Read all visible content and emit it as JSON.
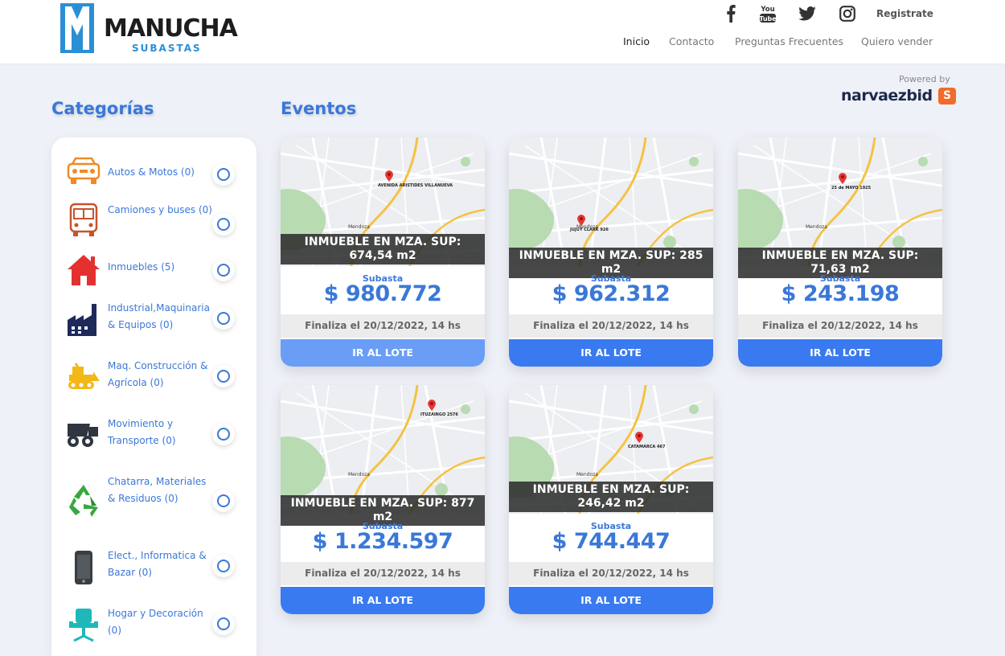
{
  "brand": {
    "name": "MANUCHA",
    "sub": "SUBASTAS"
  },
  "header": {
    "social": [
      "facebook-icon",
      "youtube-icon",
      "twitter-icon",
      "instagram-icon"
    ],
    "youtube_text": "You\nTube",
    "registrate": "Registrate",
    "nav": [
      "Inicio",
      "Contacto",
      "Preguntas Frecuentes",
      "Quiero vender"
    ]
  },
  "powered": {
    "label": "Powered by",
    "brand": "narvaezbid",
    "badge": "S"
  },
  "sidebar": {
    "title": "Categorías",
    "categories": [
      {
        "label": "Autos & Motos (0)",
        "icon": "car-icon"
      },
      {
        "label": "Camiones y buses (0)",
        "icon": "bus-icon"
      },
      {
        "label": "Inmuebles (5)",
        "icon": "house-icon"
      },
      {
        "label": "Industrial,Maquinaria & Equipos (0)",
        "icon": "factory-icon"
      },
      {
        "label": "Maq. Construcción & Agrícola (0)",
        "icon": "bulldozer-icon"
      },
      {
        "label": "Movimiento y Transporte (0)",
        "icon": "truck-icon"
      },
      {
        "label": "Chatarra, Materiales & Residuos (0)",
        "icon": "recycle-icon"
      },
      {
        "label": "Elect., Informatica & Bazar (0)",
        "icon": "phone-icon"
      },
      {
        "label": "Hogar y Decoración (0)",
        "icon": "chair-icon"
      }
    ]
  },
  "events": {
    "title": "Eventos",
    "cards": [
      {
        "title": "INMUEBLE EN MZA. SUP: 674,54 m2",
        "subtitle": "Subasta",
        "price": "$ 980.772",
        "final": "Finaliza el 20/12/2022, 14 hs",
        "button": "IR AL LOTE",
        "pin_label": "AVENIDA ARISTIDES VILLANUEVA"
      },
      {
        "title": "INMUEBLE EN MZA. SUP: 285 m2",
        "subtitle": "Subasta",
        "price": "$ 962.312",
        "final": "Finaliza el 20/12/2022, 14 hs",
        "button": "IR AL LOTE",
        "pin_label": "JUJUY CLARK 926"
      },
      {
        "title": "INMUEBLE EN MZA. SUP: 71,63 m2",
        "subtitle": "Subasta",
        "price": "$ 243.198",
        "final": "Finaliza el 20/12/2022, 14 hs",
        "button": "IR AL LOTE",
        "pin_label": "25 de MAYO 1925"
      },
      {
        "title": "INMUEBLE EN MZA. SUP: 877 m2",
        "subtitle": "Subasta",
        "price": "$ 1.234.597",
        "final": "Finaliza el 20/12/2022, 14 hs",
        "button": "IR AL LOTE",
        "pin_label": "ITUZAINGO 2576"
      },
      {
        "title": "INMUEBLE EN MZA. SUP: 246,42 m2",
        "subtitle": "Subasta",
        "price": "$ 744.447",
        "final": "Finaliza el 20/12/2022, 14 hs",
        "button": "IR AL LOTE",
        "pin_label": "CATAMARCA 467"
      }
    ]
  },
  "map_city_label": "Mendoza",
  "colors": {
    "accent": "#3a78d8",
    "button": "#3a7af0",
    "button_hover": "#6a9ef6",
    "logo": "#2b8fd6",
    "powered_badge": "#f26b2a"
  }
}
